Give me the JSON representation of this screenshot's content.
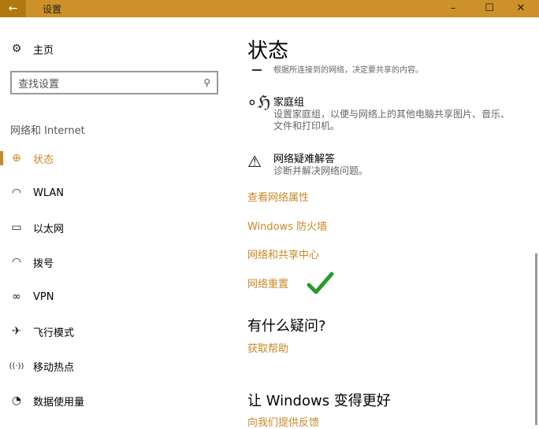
{
  "window": {
    "title": "设置",
    "back": "←",
    "minimize": "–",
    "maximize": "☐",
    "close": "✕"
  },
  "sidebar": {
    "home": "主页",
    "search_placeholder": "查找设置",
    "section": "网络和 Internet",
    "items": [
      {
        "label": "状态",
        "icon": "⊕"
      },
      {
        "label": "WLAN",
        "icon": "◠"
      },
      {
        "label": "以太网",
        "icon": "▭"
      },
      {
        "label": "拨号",
        "icon": "◠"
      },
      {
        "label": "VPN",
        "icon": "∞"
      },
      {
        "label": "飞行模式",
        "icon": "✈"
      },
      {
        "label": "移动热点",
        "icon": "((·))"
      },
      {
        "label": "数据使用量",
        "icon": "◔"
      }
    ]
  },
  "main": {
    "title": "状态",
    "clipped_text": "根据所连接到的网络，决定要共享的内容。",
    "homegroup": {
      "title": "家庭组",
      "desc1": "设置家庭组，以便与网络上的其他电脑共享图片、音乐、",
      "desc2": "文件和打印机。"
    },
    "troubleshoot": {
      "title": "网络疑难解答",
      "desc": "诊断并解决网络问题。"
    },
    "links": [
      "查看网络属性",
      "Windows 防火墙",
      "网络和共享中心",
      "网络重置"
    ],
    "question": {
      "title": "有什么疑问?",
      "link": "获取帮助"
    },
    "improve": {
      "title": "让 Windows 变得更好",
      "link": "向我们提供反馈"
    }
  },
  "colors": {
    "accent": "#c9892a",
    "titlebar": "#cc9128",
    "check": "#2a9a2a"
  }
}
